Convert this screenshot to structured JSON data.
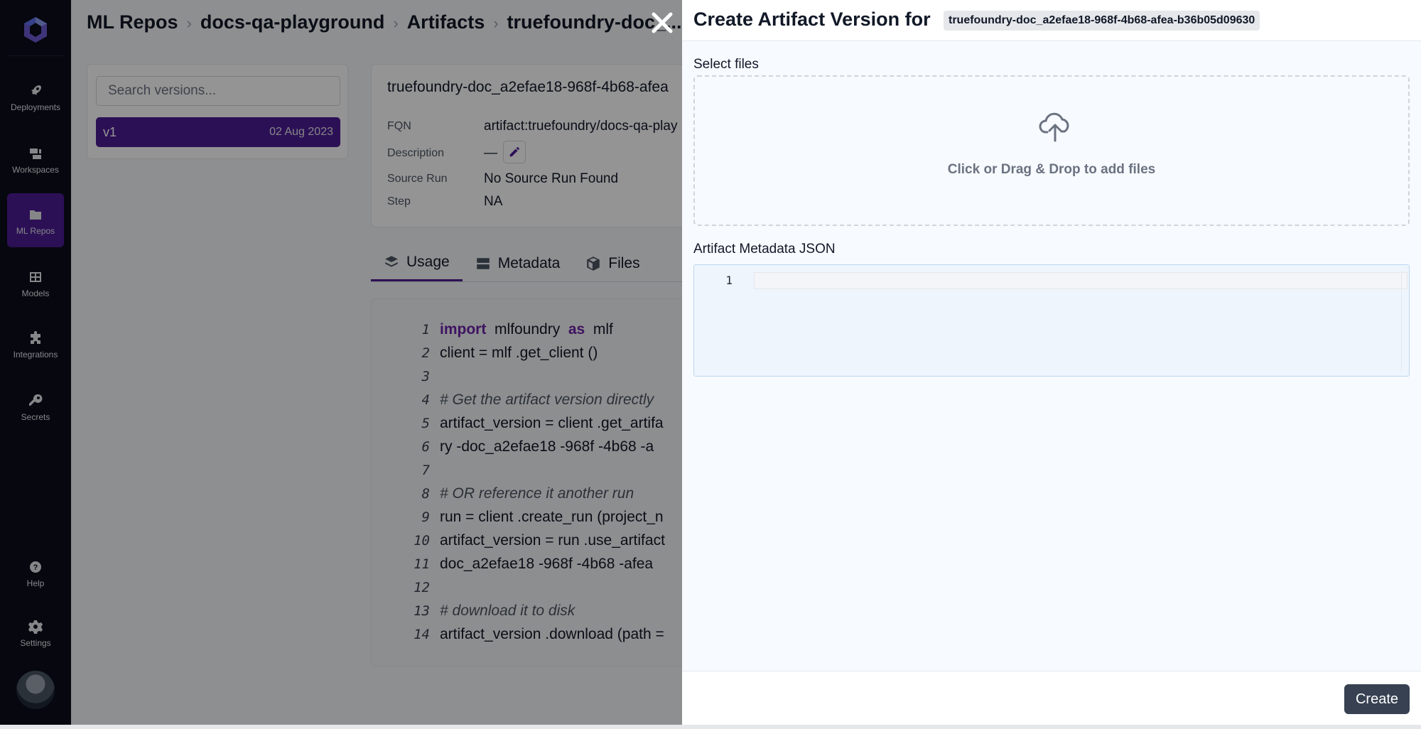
{
  "sidebar": {
    "items": [
      {
        "label": "Deployments",
        "icon": "rocket-icon"
      },
      {
        "label": "Workspaces",
        "icon": "workspace-icon"
      },
      {
        "label": "ML Repos",
        "icon": "folder-icon",
        "active": true
      },
      {
        "label": "Models",
        "icon": "grid-icon"
      },
      {
        "label": "Integrations",
        "icon": "puzzle-icon"
      },
      {
        "label": "Secrets",
        "icon": "key-icon"
      }
    ],
    "bottom": [
      {
        "label": "Help",
        "icon": "help-icon"
      },
      {
        "label": "Settings",
        "icon": "gear-icon"
      }
    ]
  },
  "breadcrumb": [
    "ML Repos",
    "docs-qa-playground",
    "Artifacts",
    "truefoundry-doc_..."
  ],
  "versions": {
    "search_placeholder": "Search versions...",
    "items": [
      {
        "label": "v1",
        "date": "02 Aug 2023"
      }
    ]
  },
  "details": {
    "title": "truefoundry-doc_a2efae18-968f-4b68-afea",
    "fqn_label": "FQN",
    "fqn_value": "artifact:truefoundry/docs-qa-play",
    "description_label": "Description",
    "description_value": "—",
    "source_run_label": "Source Run",
    "source_run_value": "No Source Run Found",
    "step_label": "Step",
    "step_value": "NA"
  },
  "tabs": [
    {
      "label": "Usage",
      "icon": "layers-icon"
    },
    {
      "label": "Metadata",
      "icon": "server-icon"
    },
    {
      "label": "Files",
      "icon": "box-icon"
    }
  ],
  "code": {
    "lines": [
      {
        "n": "1",
        "text": "import  mlfoundry  as  mlf"
      },
      {
        "n": "2",
        "text": "client  = mlf .get_client  ()"
      },
      {
        "n": "3",
        "text": ""
      },
      {
        "n": "4",
        "text": " # Get the artifact version directly"
      },
      {
        "n": "5",
        "text": "artifact_version  = client  .get_artifa"
      },
      {
        "n": "6",
        "text": " ry  -doc_a2efae18  -968f  -4b68  -a"
      },
      {
        "n": "7",
        "text": ""
      },
      {
        "n": "8",
        "text": " # OR reference it another run"
      },
      {
        "n": "9",
        "text": "run  = client  .create_run  (project_n"
      },
      {
        "n": "10",
        "text": "artifact_version  = run  .use_artifact"
      },
      {
        "n": "11",
        "text": " doc_a2efae18  -968f  -4b68  -afea"
      },
      {
        "n": "12",
        "text": ""
      },
      {
        "n": "13",
        "text": " # download it to disk"
      },
      {
        "n": "14",
        "text": "artifact_version  .download  (path  ="
      }
    ]
  },
  "drawer": {
    "title": "Create Artifact Version for",
    "artifact_name": "truefoundry-doc_a2efae18-968f-4b68-afea-b36b05d09630",
    "select_files_label": "Select files",
    "dropzone_text": "Click or Drag & Drop to add files",
    "metadata_label": "Artifact Metadata JSON",
    "editor_line_number": "1",
    "create_label": "Create"
  },
  "colors": {
    "sidebar_bg": "#0b0d1a",
    "accent": "#4c1d95",
    "create_button": "#374151"
  }
}
